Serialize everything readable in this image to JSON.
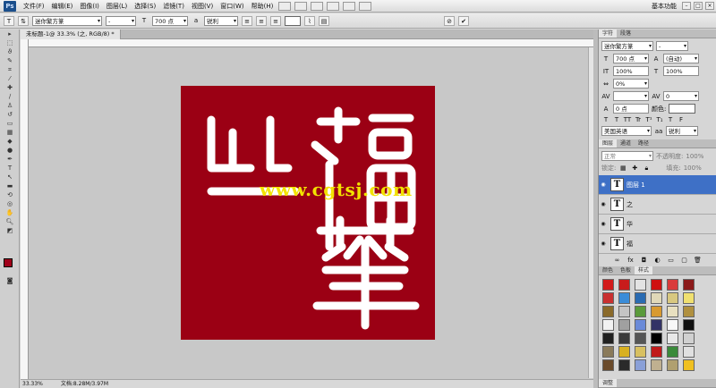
{
  "app": {
    "logo": "Ps",
    "workspace_label": "基本功能"
  },
  "menu": {
    "items": [
      "文件(F)",
      "编辑(E)",
      "图像(I)",
      "图层(L)",
      "选择(S)",
      "滤镜(T)",
      "视图(V)",
      "窗口(W)",
      "帮助(H)"
    ]
  },
  "options": {
    "font_family": "迷你繁方篆",
    "font_style": "-",
    "font_size": "700 点",
    "antialias": "锐利"
  },
  "document": {
    "tab_title": "未标题-1@ 33.3% (之, RGB/8) *",
    "zoom": "33.33%",
    "doc_info": "文档:8.28M/3.97M"
  },
  "canvas": {
    "watermark": "www.cgtsj.com",
    "foreground_color": "#a0001a",
    "background_color": "#9b0014"
  },
  "character_panel": {
    "tabs": [
      "字符",
      "段落"
    ],
    "font_family": "迷你繁方篆",
    "font_style": "-",
    "size": "700 点",
    "leading": "(自动)",
    "vscale": "100%",
    "hscale": "100%",
    "tracking_pct": "0%",
    "kerning": "0",
    "baseline": "0 点",
    "color_label": "颜色:",
    "type_buttons": [
      "T",
      "T",
      "TT",
      "Tr",
      "T¹",
      "T₁",
      "T",
      "F"
    ],
    "language": "美国英语",
    "aa_label": "aa",
    "aa_value": "锐利"
  },
  "layers_panel": {
    "tabs": [
      "图层",
      "通道",
      "路径"
    ],
    "blend_mode": "正常",
    "opacity_label": "不透明度:",
    "opacity_value": "100%",
    "lock_label": "锁定:",
    "fill_label": "填充:",
    "fill_value": "100%",
    "layers": [
      {
        "name": "图层 1",
        "selected": true
      },
      {
        "name": "之",
        "selected": false
      },
      {
        "name": "华",
        "selected": false
      },
      {
        "name": "福",
        "selected": false
      }
    ]
  },
  "styles_panel": {
    "tabs": [
      "颜色",
      "色板",
      "样式"
    ],
    "swatches": [
      "#d21a1a",
      "#c81c1c",
      "#e3e3e3",
      "#cf1010",
      "#d93a3a",
      "#8b1a1a",
      "#c93030",
      "#3a8cd8",
      "#2a6bb2",
      "#e0d8b8",
      "#d8c880",
      "#f0e070",
      "#8a6a2a",
      "#c4c4c4",
      "#5a9a3a",
      "#d89a30",
      "#e8e0c0",
      "#b09040",
      "#f2f2f2",
      "#a0a0a0",
      "#6a8ad8",
      "#333366",
      "#f8f8f8",
      "#111111",
      "#202020",
      "#3a3a3a",
      "#555555",
      "#000000",
      "#e8e8e8",
      "#d0d0d0",
      "#8a7a5a",
      "#d8b020",
      "#d8c060",
      "#c01a1a",
      "#3a8a3a",
      "#e0e0e0",
      "#6a4a2a",
      "#2a2a2a",
      "#8aa0d8",
      "#c0b090",
      "#b0a070",
      "#f0c020"
    ],
    "bottom_tab": "调整"
  }
}
